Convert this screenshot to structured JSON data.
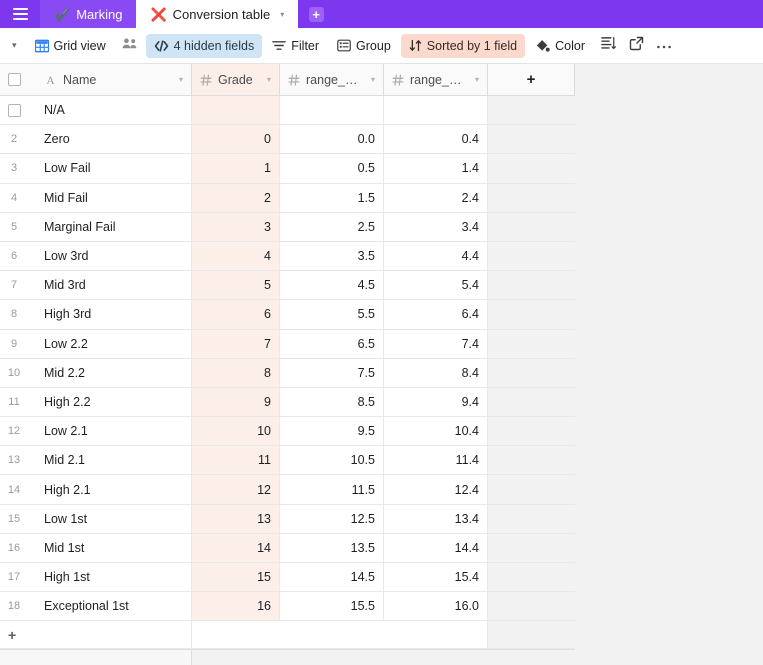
{
  "window": {
    "menu_icon": "hamburger-icon"
  },
  "tabs": {
    "items": [
      {
        "emoji": "✔️",
        "label": "Marking",
        "active": false
      },
      {
        "emoji": "❌",
        "label": "Conversion table",
        "active": true
      }
    ],
    "add_label": "+",
    "caret": "▾"
  },
  "toolbar": {
    "view_caret": "▾",
    "view_name": "Grid view",
    "collaborators_icon": "collaborators-icon",
    "hidden_fields": "4 hidden fields",
    "filter": "Filter",
    "group": "Group",
    "sort": "Sorted by 1 field",
    "color": "Color",
    "row_height_icon": "row-height-icon",
    "share_icon": "share-view-icon",
    "more_icon": "more-options-icon",
    "accent_blue": "#cfe5f5",
    "accent_peach": "#fbd9cd",
    "brand_purple": "#7c37ef"
  },
  "grid": {
    "columns": [
      {
        "key": "name",
        "label": "Name",
        "type_icon": "text-field-icon",
        "width": 164
      },
      {
        "key": "grade",
        "label": "Grade",
        "type_icon": "number-field-icon",
        "width": 88
      },
      {
        "key": "range_min",
        "label": "range_min",
        "type_icon": "number-field-icon",
        "width": 104
      },
      {
        "key": "range_max",
        "label": "range_max",
        "type_icon": "number-field-icon",
        "width": 104
      }
    ],
    "add_field_label": "+",
    "add_row_label": "+",
    "sorted_column_key": "grade",
    "sorted_column_tint": "#fcefea",
    "rows": [
      {
        "num": "",
        "first": true,
        "name": "N/A",
        "grade": "",
        "range_min": "",
        "range_max": ""
      },
      {
        "num": "2",
        "name": "Zero",
        "grade": "0",
        "range_min": "0.0",
        "range_max": "0.4"
      },
      {
        "num": "3",
        "name": "Low Fail",
        "grade": "1",
        "range_min": "0.5",
        "range_max": "1.4"
      },
      {
        "num": "4",
        "name": "Mid Fail",
        "grade": "2",
        "range_min": "1.5",
        "range_max": "2.4"
      },
      {
        "num": "5",
        "name": "Marginal Fail",
        "grade": "3",
        "range_min": "2.5",
        "range_max": "3.4"
      },
      {
        "num": "6",
        "name": "Low 3rd",
        "grade": "4",
        "range_min": "3.5",
        "range_max": "4.4"
      },
      {
        "num": "7",
        "name": "Mid 3rd",
        "grade": "5",
        "range_min": "4.5",
        "range_max": "5.4"
      },
      {
        "num": "8",
        "name": "High 3rd",
        "grade": "6",
        "range_min": "5.5",
        "range_max": "6.4"
      },
      {
        "num": "9",
        "name": "Low 2.2",
        "grade": "7",
        "range_min": "6.5",
        "range_max": "7.4"
      },
      {
        "num": "10",
        "name": "Mid 2.2",
        "grade": "8",
        "range_min": "7.5",
        "range_max": "8.4"
      },
      {
        "num": "11",
        "name": "High 2.2",
        "grade": "9",
        "range_min": "8.5",
        "range_max": "9.4"
      },
      {
        "num": "12",
        "name": "Low 2.1",
        "grade": "10",
        "range_min": "9.5",
        "range_max": "10.4"
      },
      {
        "num": "13",
        "name": "Mid 2.1",
        "grade": "11",
        "range_min": "10.5",
        "range_max": "11.4"
      },
      {
        "num": "14",
        "name": "High 2.1",
        "grade": "12",
        "range_min": "11.5",
        "range_max": "12.4"
      },
      {
        "num": "15",
        "name": "Low 1st",
        "grade": "13",
        "range_min": "12.5",
        "range_max": "13.4"
      },
      {
        "num": "16",
        "name": "Mid 1st",
        "grade": "14",
        "range_min": "13.5",
        "range_max": "14.4"
      },
      {
        "num": "17",
        "name": "High 1st",
        "grade": "15",
        "range_min": "14.5",
        "range_max": "15.4"
      },
      {
        "num": "18",
        "name": "Exceptional 1st",
        "grade": "16",
        "range_min": "15.5",
        "range_max": "16.0"
      }
    ]
  }
}
